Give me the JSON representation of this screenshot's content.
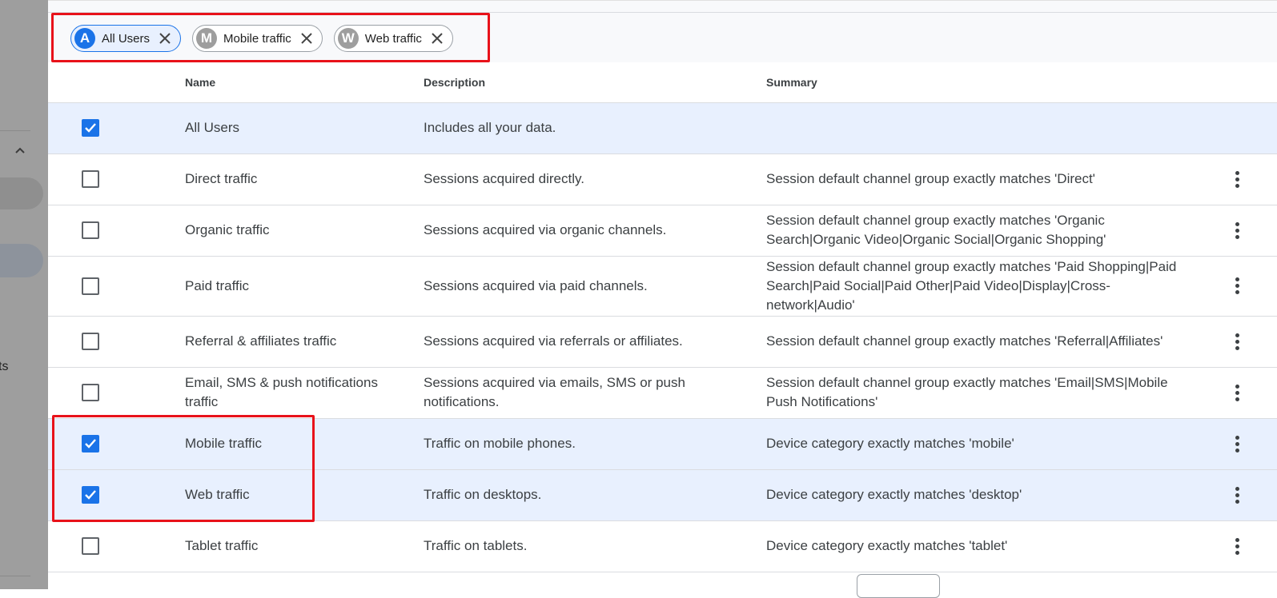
{
  "backdrop": {
    "partial_text": "ts"
  },
  "chips": [
    {
      "initial": "A",
      "label": "All Users",
      "active": true
    },
    {
      "initial": "M",
      "label": "Mobile traffic",
      "active": false
    },
    {
      "initial": "W",
      "label": "Web traffic",
      "active": false
    }
  ],
  "table": {
    "headers": {
      "name": "Name",
      "description": "Description",
      "summary": "Summary"
    },
    "rows": [
      {
        "name": "All Users",
        "description": "Includes all your data.",
        "summary": "",
        "checked": true
      },
      {
        "name": "Direct traffic",
        "description": "Sessions acquired directly.",
        "summary": "Session default channel group exactly matches 'Direct'",
        "checked": false
      },
      {
        "name": "Organic traffic",
        "description": "Sessions acquired via organic channels.",
        "summary": "Session default channel group exactly matches 'Organic Search|Organic Video|Organic Social|Organic Shopping'",
        "checked": false
      },
      {
        "name": "Paid traffic",
        "description": "Sessions acquired via paid channels.",
        "summary": "Session default channel group exactly matches 'Paid Shopping|Paid Search|Paid Social|Paid Other|Paid Video|Display|Cross-network|Audio'",
        "checked": false
      },
      {
        "name": "Referral & affiliates traffic",
        "description": "Sessions acquired via referrals or affiliates.",
        "summary": "Session default channel group exactly matches 'Referral|Affiliates'",
        "checked": false
      },
      {
        "name": "Email, SMS & push notifications traffic",
        "description": "Sessions acquired via emails, SMS or push notifications.",
        "summary": "Session default channel group exactly matches 'Email|SMS|Mobile Push Notifications'",
        "checked": false
      },
      {
        "name": "Mobile traffic",
        "description": "Traffic on mobile phones.",
        "summary": "Device category exactly matches 'mobile'",
        "checked": true
      },
      {
        "name": "Web traffic",
        "description": "Traffic on desktops.",
        "summary": "Device category exactly matches 'desktop'",
        "checked": true
      },
      {
        "name": "Tablet traffic",
        "description": "Traffic on tablets.",
        "summary": "Device category exactly matches 'tablet'",
        "checked": false
      }
    ]
  },
  "colors": {
    "accent": "#1a73e8",
    "selected_row": "#e8f0fe",
    "annotation": "#e8121a"
  }
}
